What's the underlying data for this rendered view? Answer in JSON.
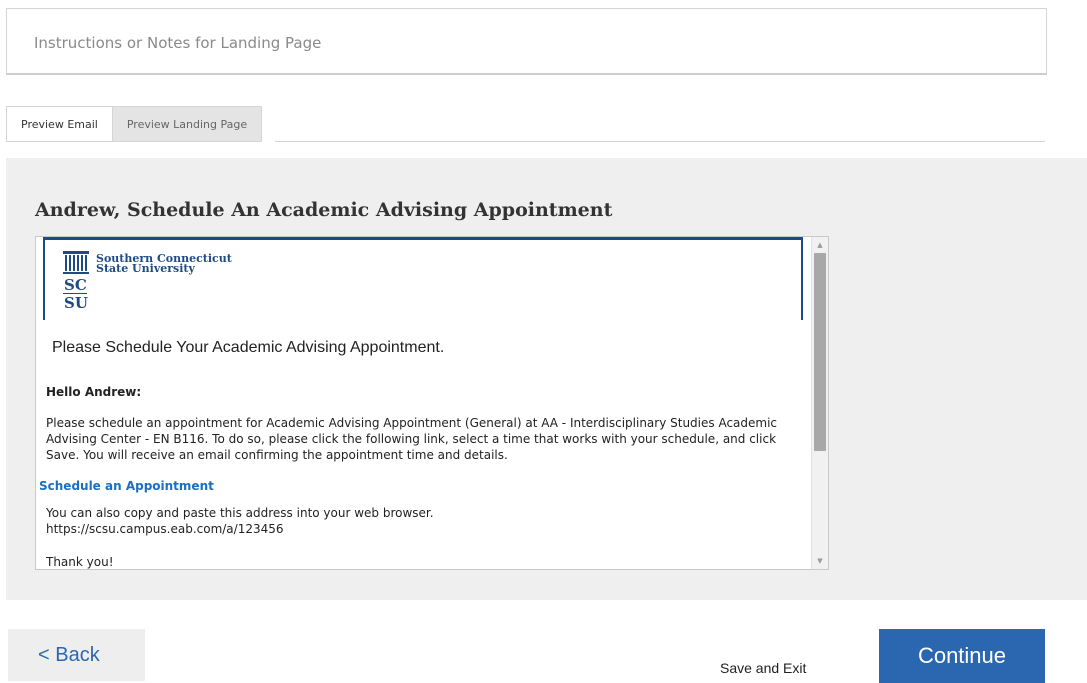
{
  "notes": {
    "placeholder": "Instructions or Notes for Landing Page"
  },
  "tabs": [
    {
      "label": "Preview Email",
      "active": true
    },
    {
      "label": "Preview Landing Page",
      "active": false
    }
  ],
  "preview": {
    "title": "Andrew, Schedule An Academic Advising Appointment",
    "email": {
      "logo": {
        "name_line1": "Southern Connecticut",
        "name_line2": "State University",
        "mark": "SCSU",
        "brand_color": "#1f4b85"
      },
      "heading": "Please Schedule Your Academic Advising Appointment.",
      "greeting": "Hello Andrew:",
      "body": "Please schedule an appointment for Academic Advising Appointment (General) at AA - Interdisciplinary Studies Academic Advising Center - EN B116. To do so, please click the following link, select a time that works with your schedule, and click Save. You will receive an email confirming the appointment time and details.",
      "link_label": "Schedule an Appointment",
      "copy_text": "You can also copy and paste this address into your web browser.",
      "url": "https://scsu.campus.eab.com/a/123456",
      "closing": "Thank you!"
    }
  },
  "footer": {
    "back_label": "< Back",
    "save_exit_label": "Save and Exit",
    "continue_label": "Continue"
  },
  "colors": {
    "accent": "#2a67b0",
    "link": "#1a6fc0",
    "panel_bg": "#efefef"
  }
}
